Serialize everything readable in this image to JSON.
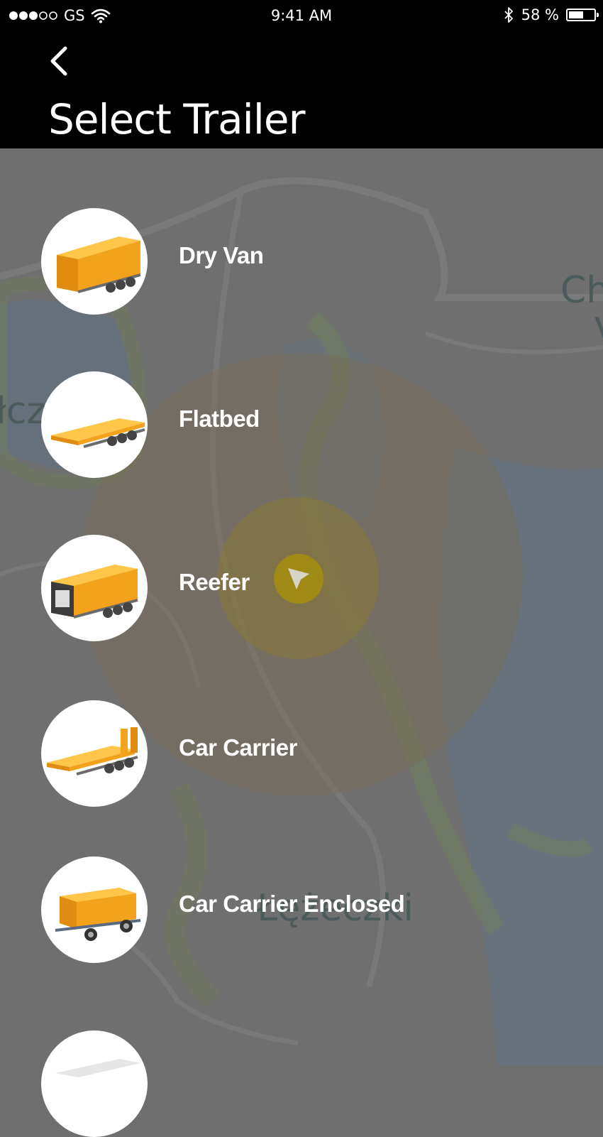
{
  "status_bar": {
    "carrier": "GS",
    "time": "9:41 AM",
    "battery_text": "58 %",
    "battery_level": 0.58
  },
  "header": {
    "title": "Select Trailer",
    "back_icon": "chevron-left-icon"
  },
  "map": {
    "labels": [
      "Ch",
      "V",
      "łcz",
      "Łężeczki"
    ],
    "location_icon": "navigation-arrow-icon"
  },
  "trailers": [
    {
      "label": "Dry Van",
      "icon": "dry-van-trailer-icon"
    },
    {
      "label": "Flatbed",
      "icon": "flatbed-trailer-icon"
    },
    {
      "label": "Reefer",
      "icon": "reefer-trailer-icon"
    },
    {
      "label": "Car Carrier",
      "icon": "car-carrier-trailer-icon"
    },
    {
      "label": "Car Carrier Enclosed",
      "icon": "car-carrier-enclosed-trailer-icon"
    }
  ],
  "colors": {
    "header_bg": "#000000",
    "overlay": "#6e6e6e",
    "trailer_orange": "#f5a623",
    "pin": "#a08a16"
  }
}
